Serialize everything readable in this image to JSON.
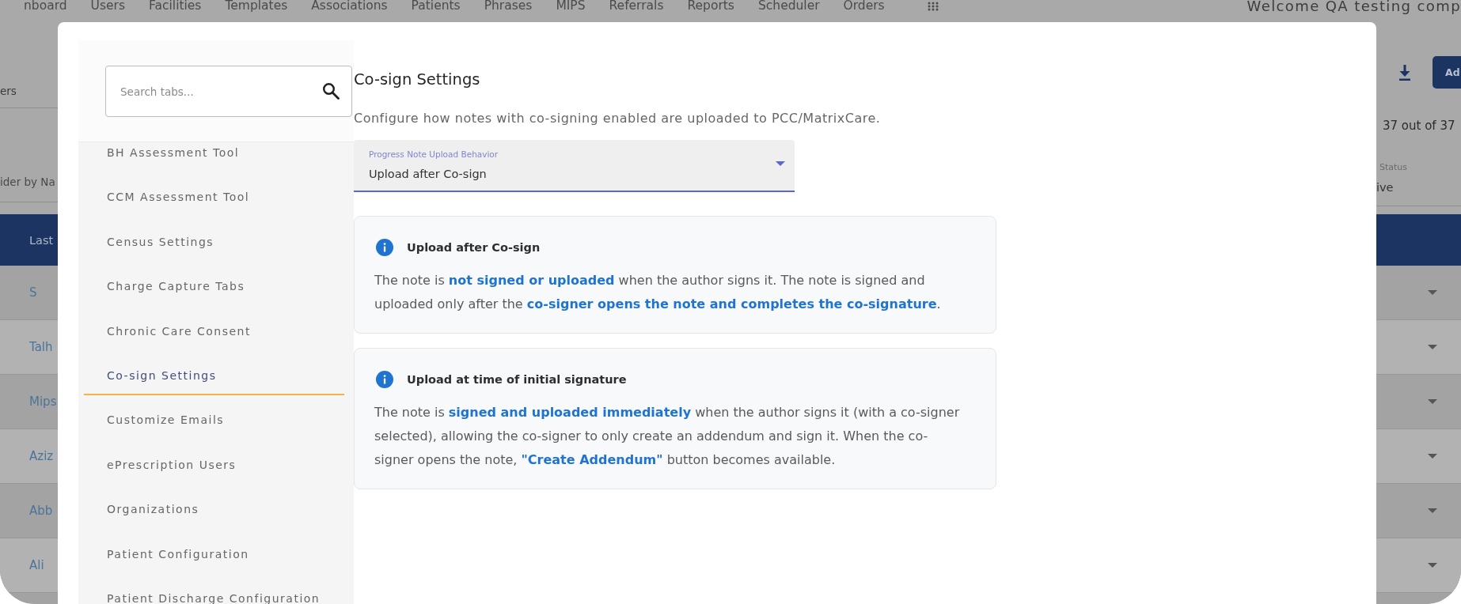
{
  "background_page": {
    "nav_links": [
      "nboard",
      "Users",
      "Facilities",
      "Templates",
      "Associations",
      "Patients",
      "Phrases",
      "MIPS",
      "Referrals",
      "Reports",
      "Scheduler",
      "Orders"
    ],
    "welcome_text": "Welcome QA testing comp",
    "left_panel": {
      "tab": "ers",
      "search": {
        "placeholder": "ider by Na"
      }
    },
    "right_panel": {
      "add_button": "Ad",
      "count": "37 out of 37",
      "status_filter": {
        "label": "Status",
        "value": "ive"
      }
    },
    "table": {
      "columns": [
        "Last"
      ],
      "rows": [
        "S",
        "Talh",
        "Mips",
        "Aziz",
        "Abb",
        "Ali"
      ]
    }
  },
  "dialog": {
    "sidebar": {
      "search": {
        "placeholder": "Search tabs..."
      },
      "items": [
        {
          "label": "BH Assessment Tool",
          "selected": false
        },
        {
          "label": "CCM Assessment Tool",
          "selected": false
        },
        {
          "label": "Census Settings",
          "selected": false
        },
        {
          "label": "Charge Capture Tabs",
          "selected": false
        },
        {
          "label": "Chronic Care Consent",
          "selected": false
        },
        {
          "label": "Co-sign Settings",
          "selected": true
        },
        {
          "label": "Customize Emails",
          "selected": false
        },
        {
          "label": "ePrescription Users",
          "selected": false
        },
        {
          "label": "Organizations",
          "selected": false
        },
        {
          "label": "Patient Configuration",
          "selected": false
        },
        {
          "label": "Patient Discharge Configuration",
          "selected": false
        }
      ]
    },
    "title": "Co-sign Settings",
    "description": "Configure how notes with co-signing enabled are uploaded to PCC/MatrixCare.",
    "upload_behavior": {
      "label": "Progress Note Upload Behavior",
      "value": "Upload after Co-sign"
    },
    "options": [
      {
        "title": "Upload after Co-sign",
        "text": "The note is **not signed or uploaded** when the author signs it. The note is signed and uploaded only after the **co-signer opens the note and completes the co-signature**."
      },
      {
        "title": "Upload at time of initial signature",
        "text": "The note is **signed and uploaded immediately** when the author signs it (with a co-signer selected), allowing the co-signer to only create an addendum and sign it. When the co-signer opens the note, **\"Create Addendum\"** button becomes available."
      }
    ]
  }
}
